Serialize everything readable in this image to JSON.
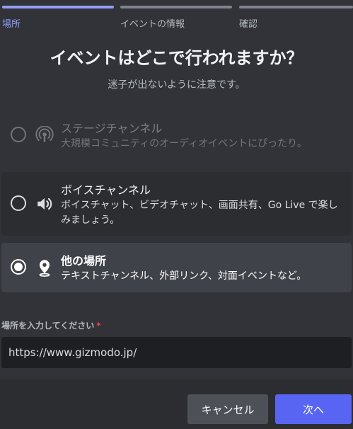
{
  "steps": [
    {
      "label": "場所",
      "active": true
    },
    {
      "label": "イベントの情報",
      "active": false
    },
    {
      "label": "確認",
      "active": false
    }
  ],
  "title": "イベントはどこで行われますか？",
  "subtitle": "迷子が出ないように注意です。",
  "options": [
    {
      "title": "ステージチャンネル",
      "desc": "大規模コミュニティのオーディオイベントにぴったり。",
      "icon": "stage-channel-icon",
      "selected": false,
      "disabled": true
    },
    {
      "title": "ボイスチャンネル",
      "desc": "ボイスチャット、ビデオチャット、画面共有、Go Live で楽しみましょう。",
      "icon": "speaker-icon",
      "selected": false,
      "disabled": false
    },
    {
      "title": "他の場所",
      "desc": "テキストチャンネル、外部リンク、対面イベントなど。",
      "icon": "location-pin-icon",
      "selected": true,
      "disabled": false
    }
  ],
  "location": {
    "label": "場所を入力してください",
    "required_mark": "*",
    "value": "https://www.gizmodo.jp/"
  },
  "buttons": {
    "cancel": "キャンセル",
    "next": "次へ"
  },
  "colors": {
    "accent": "#5865f2",
    "progress_active": "#949cf7",
    "background": "#313338"
  }
}
